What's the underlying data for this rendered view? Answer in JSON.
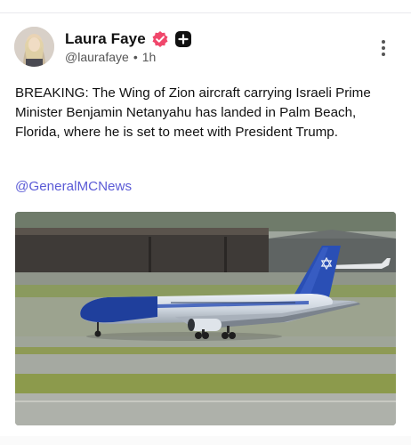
{
  "post": {
    "author_name": "Laura Faye",
    "handle": "@laurafaye",
    "separator": "•",
    "time_ago": "1h",
    "text": "BREAKING: The Wing of Zion aircraft carrying Israeli Prime Minister Benjamin Netanyahu has landed in Palm Beach, Florida, where he is set to meet with President Trump.",
    "mention": "@GeneralMCNews"
  },
  "icons": {
    "verified": "verified-badge-icon",
    "plus": "plus-badge-icon",
    "more": "more-vertical-icon"
  },
  "colors": {
    "verified_badge": "#f0476b",
    "mention_link": "#5b5bd6",
    "plane_fuselage": "#1f3f9c",
    "plane_tail": "#2a4fb5"
  }
}
